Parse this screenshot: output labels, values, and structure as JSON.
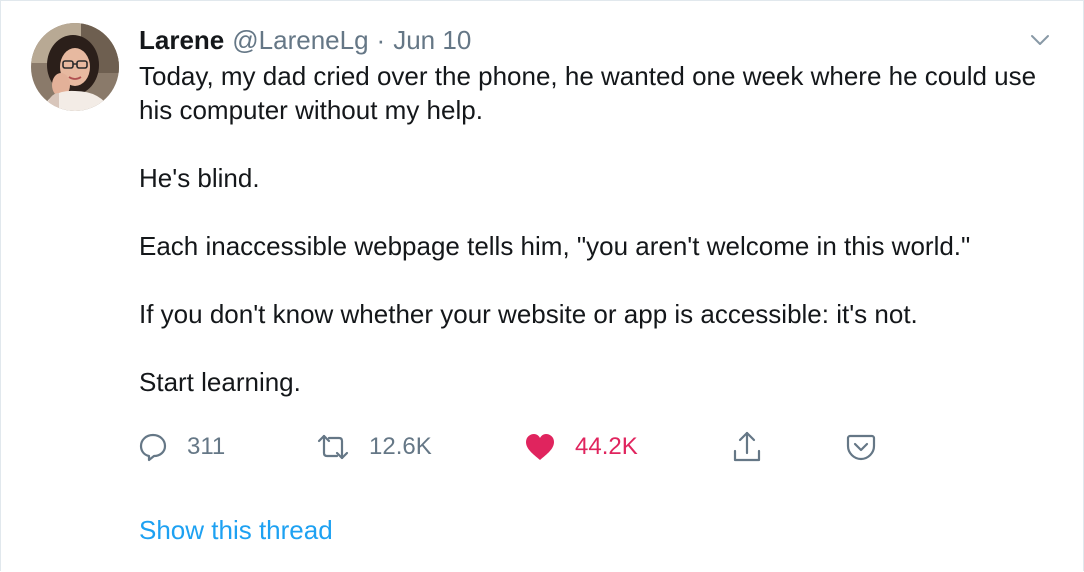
{
  "tweet": {
    "author_name": "Larene",
    "author_handle": "@LareneLg",
    "separator": "·",
    "date": "Jun 10",
    "paragraphs": [
      "Today, my dad cried over the phone, he wanted one week where he could use his computer without my help.",
      "He's blind.",
      "Each inaccessible webpage tells him, \"you aren't welcome in this world.\"",
      "If you don't know whether your website or app is accessible: it's not.",
      "Start learning."
    ],
    "actions": {
      "reply": {
        "icon": "reply-icon",
        "count": "311"
      },
      "retweet": {
        "icon": "retweet-icon",
        "count": "12.6K"
      },
      "like": {
        "icon": "heart-icon",
        "count": "44.2K",
        "liked": true
      },
      "share": {
        "icon": "share-icon"
      },
      "save": {
        "icon": "save-pocket-icon"
      }
    },
    "show_thread": "Show this thread"
  },
  "colors": {
    "text": "#14171a",
    "muted": "#657786",
    "link": "#1da1f2",
    "like": "#e0245e",
    "border": "#e1e8ed"
  }
}
